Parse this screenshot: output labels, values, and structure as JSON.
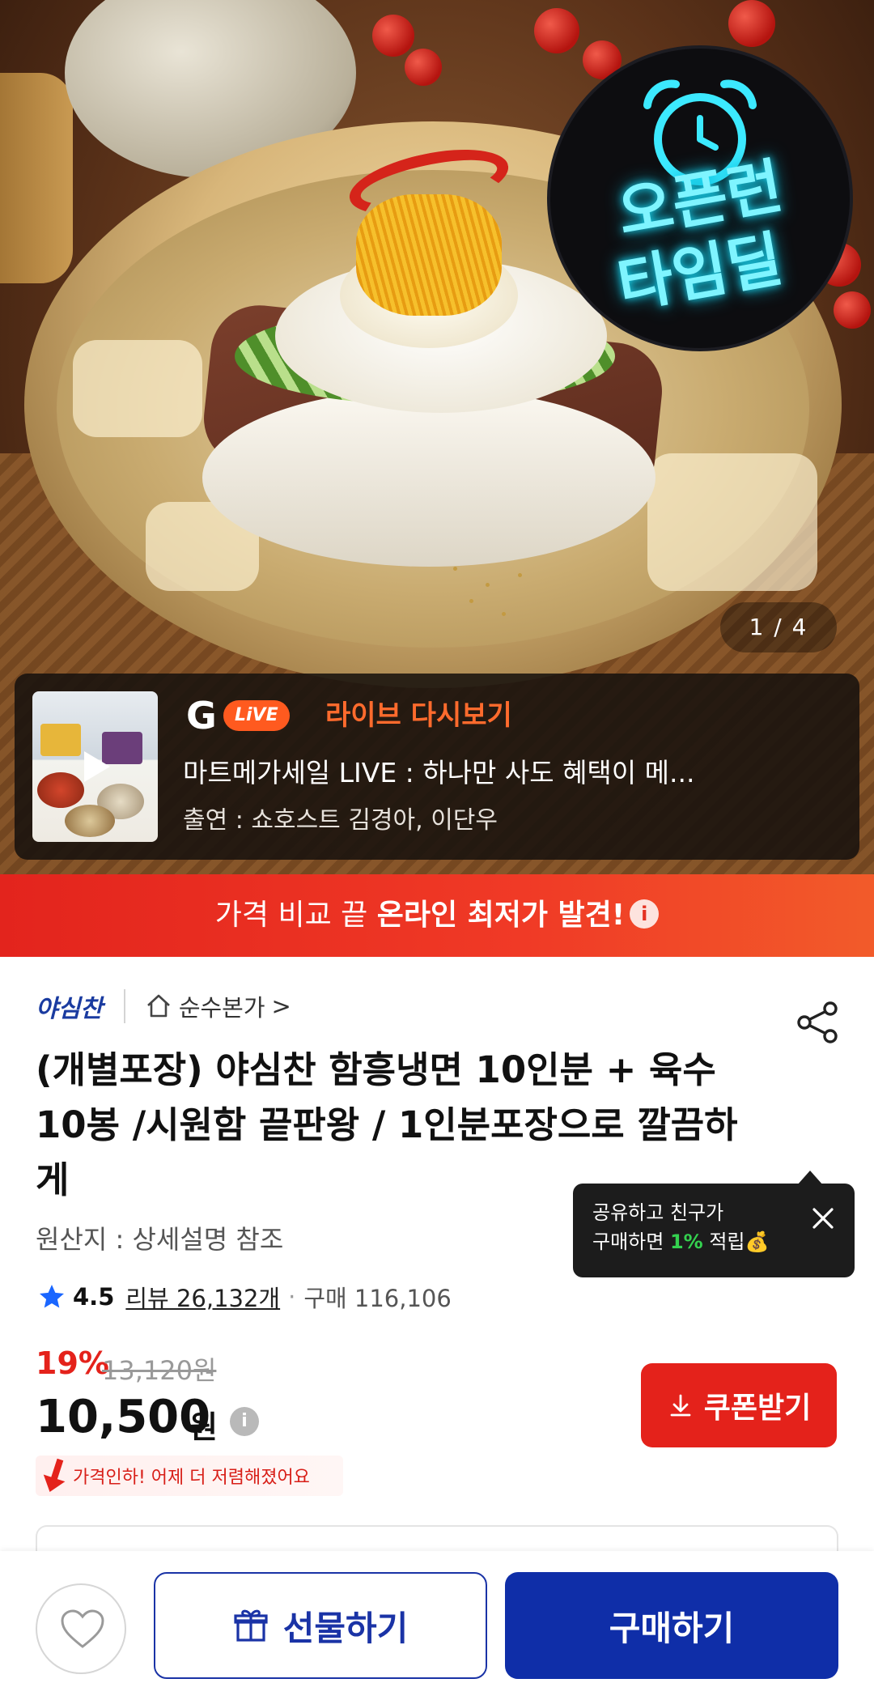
{
  "hero": {
    "badge_line1": "오픈런",
    "badge_line2": "타임딜",
    "counter": "1 / 4"
  },
  "live": {
    "logo_letter": "G",
    "pill": "LiVE",
    "label": "라이브 다시보기",
    "title": "마트메가세일 LIVE : 하나만 사도 혜택이 메...",
    "cast": "출연 : 쇼호스트 김경아, 이단우"
  },
  "compare_banner": {
    "normal": "가격 비교 끝 ",
    "strong": "온라인 최저가 발견!",
    "info": "i"
  },
  "product": {
    "brand": "야심찬",
    "store": "순수본가",
    "store_chevron": ">",
    "title": "(개별포장) 야심찬 함흥냉면 10인분  + 육수10봉 /시원함 끝판왕 / 1인분포장으로 깔끔하게",
    "origin": "원산지 : 상세설명 참조",
    "rating": "4.5",
    "reviews": "리뷰 26,132개",
    "separator": "·",
    "purchases": "구매 116,106"
  },
  "tooltip": {
    "line1": "공유하고 친구가",
    "line2_a": "구매하면 ",
    "line2_pct": "1%",
    "line2_b": " 적립",
    "money_emoji": "💰"
  },
  "price": {
    "discount": "19%",
    "original": "13,120원",
    "current": "10,500",
    "unit": "원",
    "info": "i",
    "drop_notice": "가격인하! 어제 더 저렴해졌어요",
    "coupon_button": "쿠폰받기"
  },
  "bottom_bar": {
    "gift_button": "선물하기",
    "buy_button": "구매하기"
  },
  "colors": {
    "accent_red": "#e4221b",
    "brand_blue": "#0f2ea8",
    "live_orange": "#ff5a1f",
    "neon_cyan": "#7ff4ff"
  }
}
